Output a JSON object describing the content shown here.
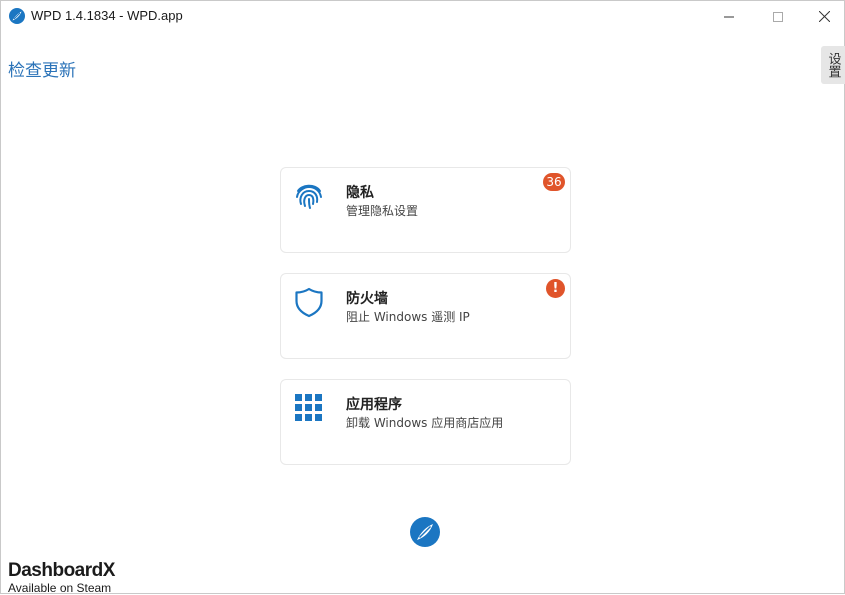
{
  "window": {
    "title": "WPD 1.4.1834 - WPD.app",
    "logo_icon": "wpd-logo-icon",
    "controls": {
      "minimize_icon": "minimize-icon",
      "maximize_icon": "maximize-icon",
      "close_icon": "close-icon"
    }
  },
  "header": {
    "check_update": "检查更新",
    "settings": "设置"
  },
  "cards": [
    {
      "title": "隐私",
      "subtitle": "管理隐私设置",
      "icon": "fingerprint-icon",
      "badge": "36"
    },
    {
      "title": "防火墙",
      "subtitle": "阻止 Windows 遥测 IP",
      "icon": "shield-icon",
      "badge": "!"
    },
    {
      "title": "应用程序",
      "subtitle": "卸载 Windows 应用商店应用",
      "icon": "apps-grid-icon"
    }
  ],
  "footer": {
    "logo_icon": "wpd-logo-icon"
  },
  "watermark": {
    "brand": "DashboardX",
    "sub": "Available on Steam"
  },
  "colors": {
    "accent": "#1b76c2",
    "link": "#2b73b8",
    "badge": "#e0542a"
  }
}
